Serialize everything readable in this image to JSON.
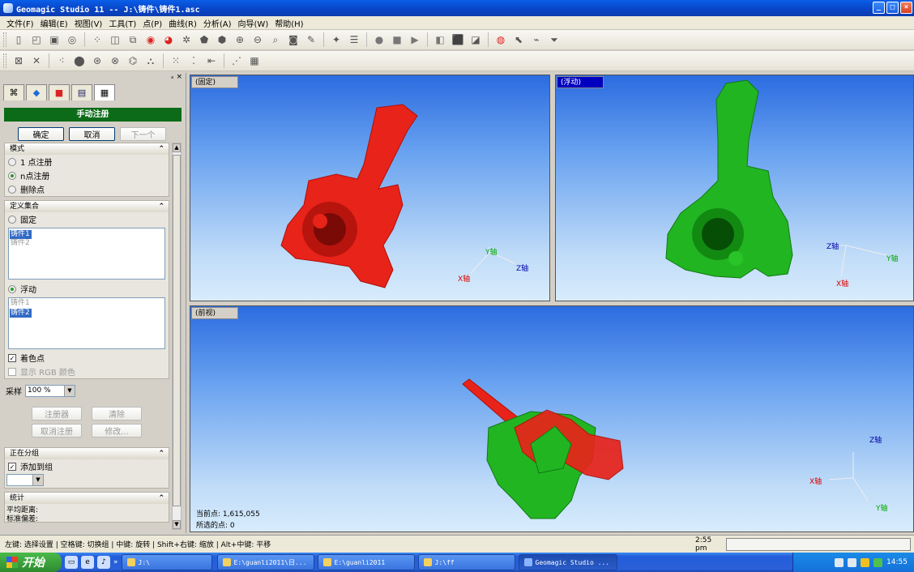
{
  "window": {
    "title": "Geomagic Studio 11 -- J:\\铸件\\铸件1.asc",
    "minimize": "_",
    "maximize": "□",
    "close": "×"
  },
  "menu": [
    "文件(F)",
    "编辑(E)",
    "视图(V)",
    "工具(T)",
    "点(P)",
    "曲线(R)",
    "分析(A)",
    "向导(W)",
    "帮助(H)"
  ],
  "panel": {
    "pin": "ₓ ×",
    "title": "手动注册",
    "ok": "确定",
    "cancel": "取消",
    "next": "下一个",
    "mode": {
      "header": "模式",
      "options": [
        "1 点注册",
        "n点注册",
        "删除点"
      ],
      "selected": 1
    },
    "define": {
      "header": "定义集合",
      "fixed_label": "固定",
      "fixed_items": [
        "铸件1",
        "铸件2"
      ],
      "floating_label": "浮动",
      "floating_items": [
        "铸件1",
        "铸件2"
      ]
    },
    "color_points": "着色点",
    "show_rgb": "显示 RGB 颜色",
    "sampling_label": "采样",
    "sampling_value": "100 %",
    "register_btn": "注册器",
    "clear_btn": "清除",
    "unregister_btn": "取消注册",
    "modify_btn": "修改...",
    "grouping": {
      "header": "正在分组",
      "add_to_group": "添加到组"
    },
    "stats": {
      "header": "统计",
      "avg_distance": "平均距离:",
      "std_dev": "标准偏差:"
    }
  },
  "viewports": {
    "fixed": {
      "label": "(固定)"
    },
    "floating": {
      "label": "(浮动)"
    },
    "front": {
      "label": "(前视)",
      "current_points": "当前点: 1,615,055",
      "selected_points": "所选的点: 0"
    }
  },
  "axes": {
    "x": "X轴",
    "y": "Y轴",
    "z": "Z轴"
  },
  "status": {
    "hint": "左键: 选择设置 | 空格键: 切换组 | 中键: 旋转 | Shift+右键: 缩放 | Alt+中键: 平移",
    "time": "2:55 pm"
  },
  "taskbar": {
    "start": "开始",
    "tasks": [
      "J:\\",
      "E:\\guanli2011\\日...",
      "E:\\guanli2011",
      "J:\\ff",
      "Geomagic Studio ..."
    ],
    "clock": "14:55"
  },
  "colors": {
    "fixed_model": "#e8231a",
    "floating_model": "#22b522",
    "panel_header": "#0c6b18"
  }
}
